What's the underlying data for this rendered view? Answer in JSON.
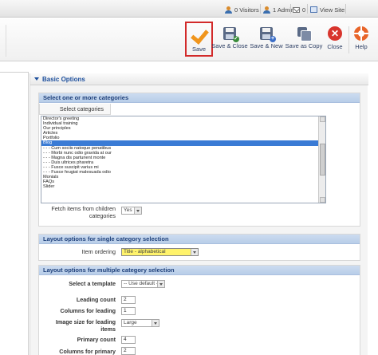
{
  "status_bar": {
    "visitors": "0 Visitors",
    "admins": "1 Admin",
    "messages": "0",
    "view_site": "View Site"
  },
  "toolbar": {
    "save": "Save",
    "save_close": "Save & Close",
    "save_new": "Save & New",
    "save_copy": "Save as Copy",
    "close": "Close",
    "help": "Help"
  },
  "panel": {
    "title": "Basic Options"
  },
  "categories_section": {
    "heading": "Select one or more categories",
    "tab_label": "Select categories",
    "options": [
      "Director's greeting",
      "Individual training",
      "Our principles",
      "Articles",
      "Portfolio",
      "Blog",
      "- - - Cum sociis natoque penatibus",
      "- - - Morbi nunc odio gravida at our",
      "- - - Magna dis parturient monte",
      "- - - Duis ultrices pharetra",
      "- - - Fusce suscipit varius mi",
      "- - - Fusce feugiat malesuada odio",
      "Monials",
      "FAQs",
      "Slider"
    ],
    "selected_option": "Blog",
    "fetch_label": "Fetch items from children categories",
    "fetch_value": "Yes"
  },
  "single_section": {
    "heading": "Layout options for single category selection",
    "item_ordering_label": "Item ordering",
    "item_ordering_value": "Title - alphabetical"
  },
  "multiple_section": {
    "heading": "Layout options for multiple category selection",
    "template_label": "Select a template",
    "template_value": "-- Use default --",
    "leading_count_label": "Leading count",
    "leading_count_value": "2",
    "columns_leading_label": "Columns for leading",
    "columns_leading_value": "1",
    "image_size_label": "Image size for leading items",
    "image_size_value": "Large",
    "primary_count_label": "Primary count",
    "primary_count_value": "4",
    "columns_primary_label": "Columns for primary",
    "columns_primary_value": "2"
  },
  "colors": {
    "accent": "#1d4f9c",
    "save_highlight": "#d22a2a",
    "selected_row": "#3a7bd5",
    "section_header": "#c3d5ec"
  }
}
